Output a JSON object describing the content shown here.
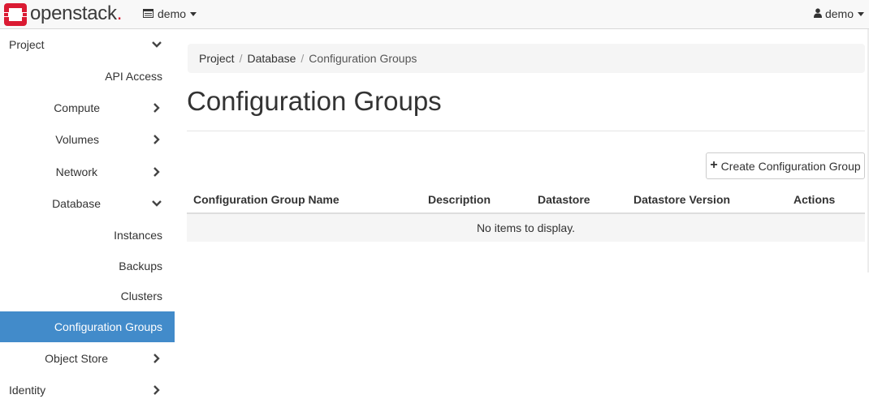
{
  "brand": {
    "name": "openstack",
    "dot": ".",
    "accent": "#da1a32"
  },
  "header": {
    "project_label": "demo",
    "user_label": "demo"
  },
  "sidebar": {
    "items": [
      {
        "label": "Project"
      },
      {
        "label": "API Access"
      },
      {
        "label": "Compute"
      },
      {
        "label": "Volumes"
      },
      {
        "label": "Network"
      },
      {
        "label": "Database"
      },
      {
        "label": "Instances"
      },
      {
        "label": "Backups"
      },
      {
        "label": "Clusters"
      },
      {
        "label": "Configuration Groups"
      },
      {
        "label": "Object Store"
      },
      {
        "label": "Identity"
      }
    ],
    "active_color": "#428bca"
  },
  "breadcrumb": {
    "items": [
      "Project",
      "Database",
      "Configuration Groups"
    ]
  },
  "page": {
    "title": "Configuration Groups",
    "create_button": "Create Configuration Group"
  },
  "table": {
    "columns": [
      "Configuration Group Name",
      "Description",
      "Datastore",
      "Datastore Version",
      "Actions"
    ],
    "empty_message": "No items to display."
  }
}
